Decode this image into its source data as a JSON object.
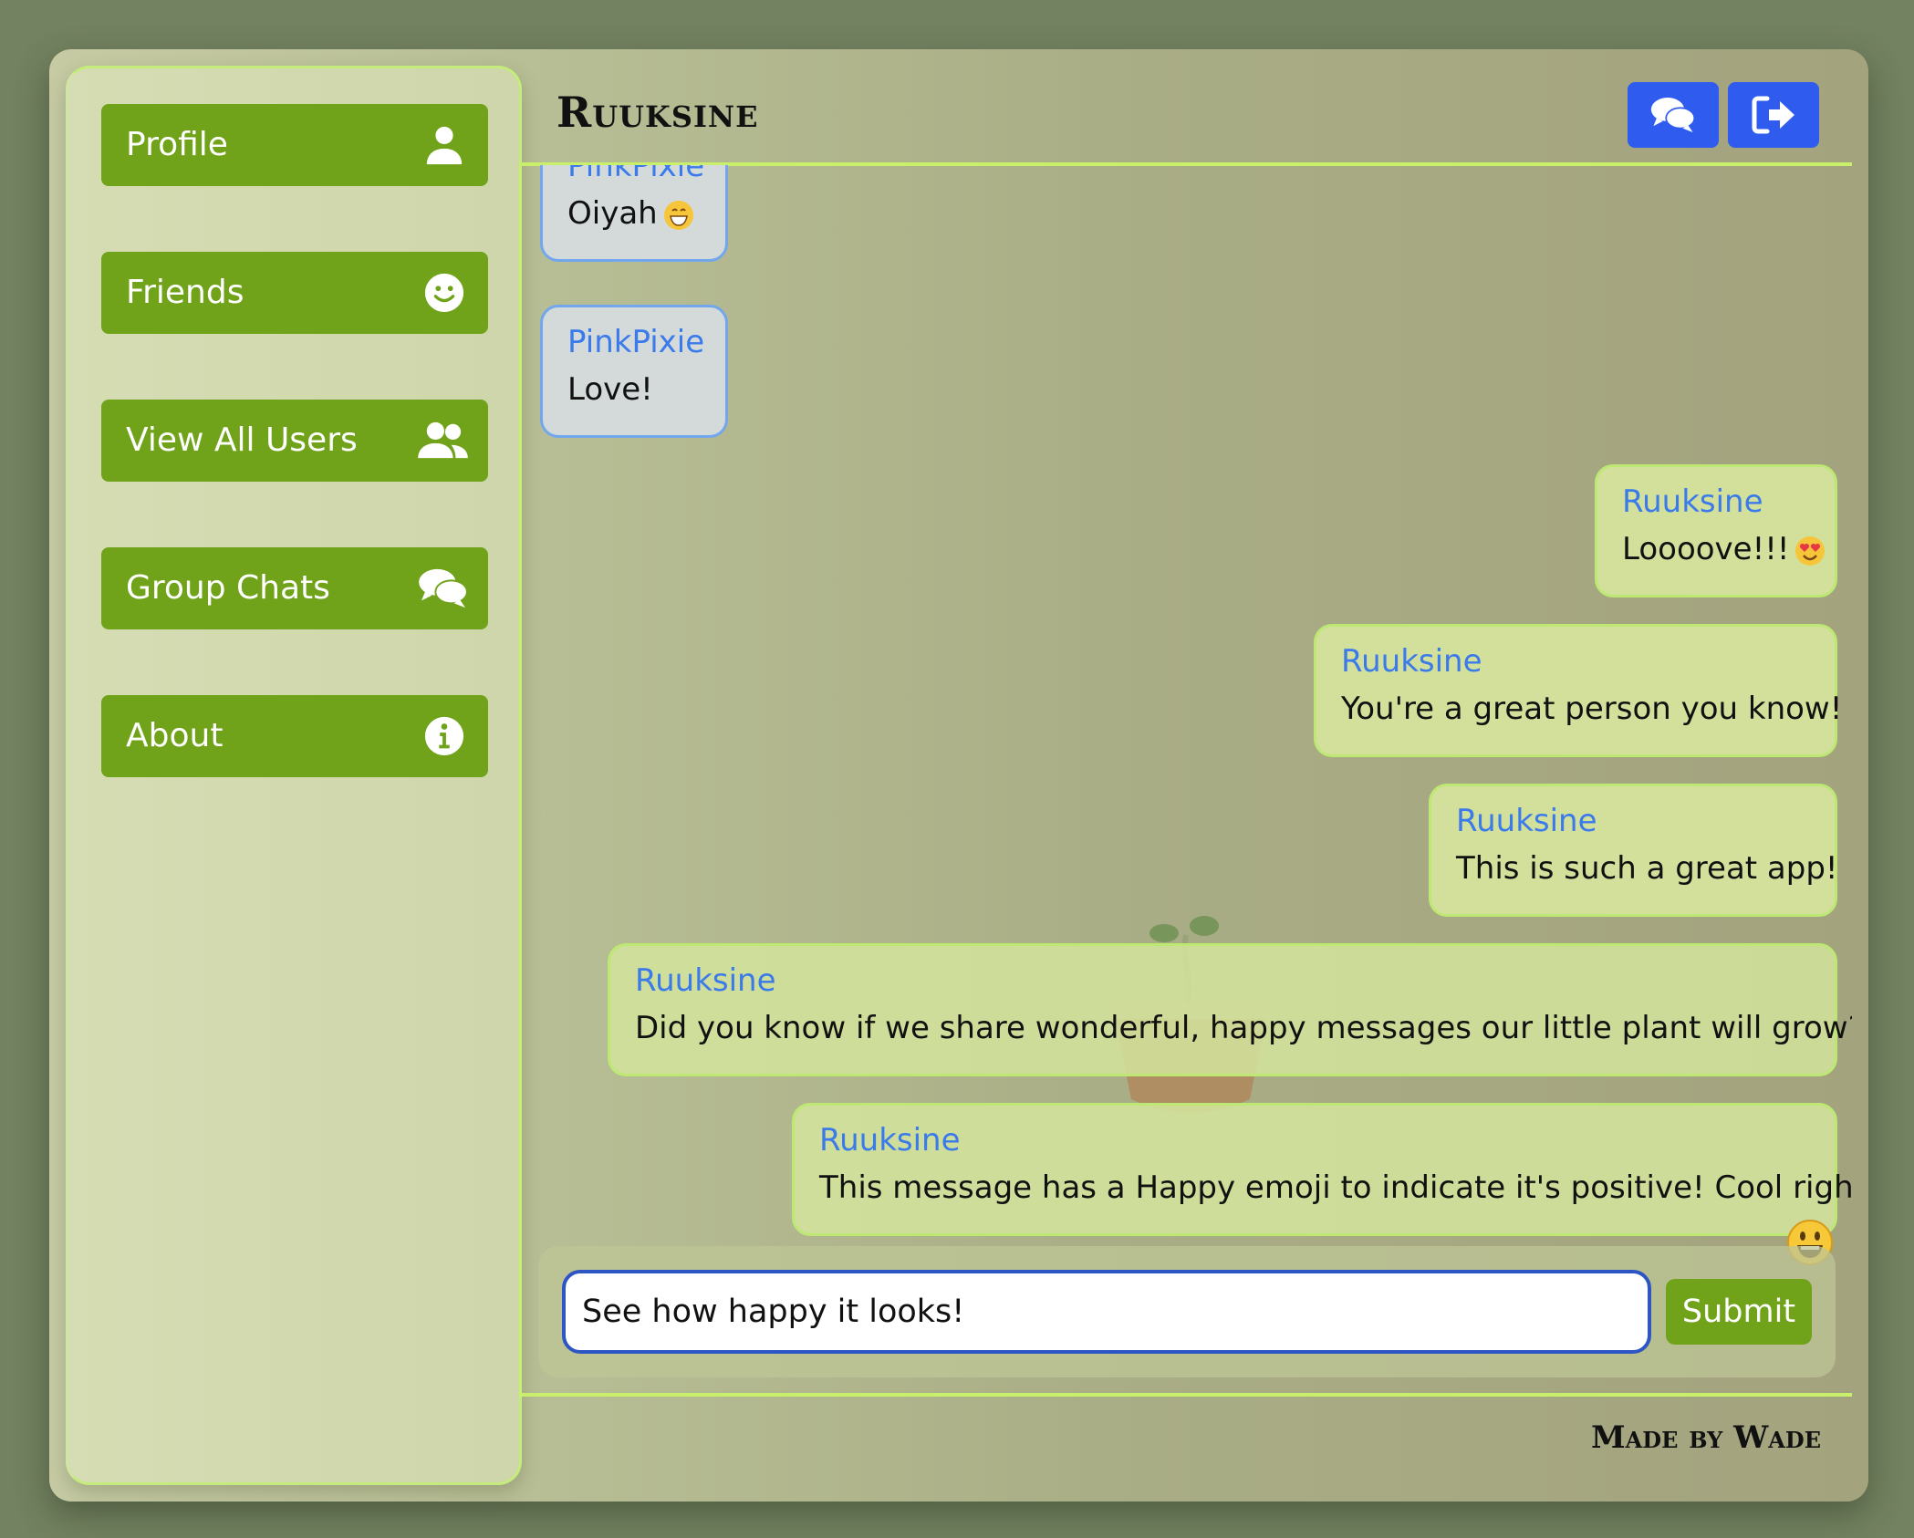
{
  "sidebar": {
    "items": [
      {
        "label": "Profile",
        "icon": "user-icon"
      },
      {
        "label": "Friends",
        "icon": "smile-icon"
      },
      {
        "label": "View All Users",
        "icon": "users-icon"
      },
      {
        "label": "Group Chats",
        "icon": "comments-icon"
      },
      {
        "label": "About",
        "icon": "info-icon"
      }
    ]
  },
  "header": {
    "title": "Ruuksine",
    "buttons": [
      {
        "icon": "comments-icon"
      },
      {
        "icon": "sign-out-icon"
      }
    ]
  },
  "messages": [
    {
      "author": "PinkPixie",
      "text": "Oiyah",
      "emoji": "grin-icon",
      "side": "left"
    },
    {
      "author": "PinkPixie",
      "text": "Love!",
      "side": "left"
    },
    {
      "author": "Ruuksine",
      "text": "Loooove!!!",
      "emoji": "heart-eyes-icon",
      "side": "right"
    },
    {
      "author": "Ruuksine",
      "text": "You're a great person you know!",
      "side": "right"
    },
    {
      "author": "Ruuksine",
      "text": "This is such a great app!",
      "side": "right"
    },
    {
      "author": "Ruuksine",
      "text": "Did you know if we share wonderful, happy messages our little plant will grow?",
      "side": "right"
    },
    {
      "author": "Ruuksine",
      "text": "This message has a Happy emoji to indicate it's positive! Cool right?",
      "side": "right",
      "sentiment": "happy-face-icon"
    }
  ],
  "composer": {
    "value": "See how happy it looks!",
    "submit_label": "Submit"
  },
  "footer": {
    "text": "Made by Wade"
  },
  "colors": {
    "nav_green": "#70a31a",
    "header_blue": "#2f5bef",
    "author_blue": "#3a7aeb",
    "accent_lime": "#c8f06a"
  }
}
